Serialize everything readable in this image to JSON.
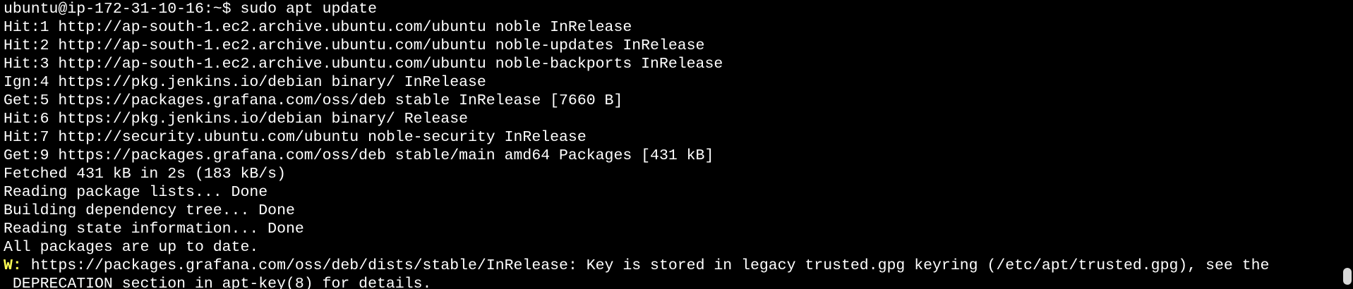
{
  "terminal": {
    "lines": [
      "ubuntu@ip-172-31-10-16:~$ sudo apt update",
      "Hit:1 http://ap-south-1.ec2.archive.ubuntu.com/ubuntu noble InRelease",
      "Hit:2 http://ap-south-1.ec2.archive.ubuntu.com/ubuntu noble-updates InRelease",
      "Hit:3 http://ap-south-1.ec2.archive.ubuntu.com/ubuntu noble-backports InRelease",
      "Ign:4 https://pkg.jenkins.io/debian binary/ InRelease",
      "Get:5 https://packages.grafana.com/oss/deb stable InRelease [7660 B]",
      "Hit:6 https://pkg.jenkins.io/debian binary/ Release",
      "Hit:7 http://security.ubuntu.com/ubuntu noble-security InRelease",
      "Get:9 https://packages.grafana.com/oss/deb stable/main amd64 Packages [431 kB]",
      "Fetched 431 kB in 2s (183 kB/s)",
      "Reading package lists... Done",
      "Building dependency tree... Done",
      "Reading state information... Done",
      "All packages are up to date."
    ],
    "warning": {
      "label": "W:",
      "text": " https://packages.grafana.com/oss/deb/dists/stable/InRelease: Key is stored in legacy trusted.gpg keyring (/etc/apt/trusted.gpg), see the",
      "continuation": "DEPRECATION section in apt-key(8) for details."
    },
    "colors": {
      "background": "#000000",
      "foreground": "#ffffff",
      "warning_label": "#ffff54",
      "scrollbar_thumb": "#d8d8d8"
    }
  }
}
